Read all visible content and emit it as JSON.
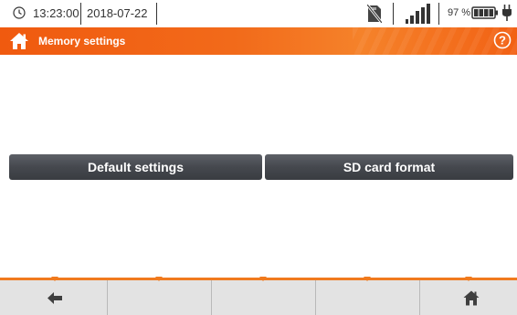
{
  "status": {
    "time": "13:23:00",
    "date": "2018-07-22",
    "battery_percent": "97 %",
    "battery_level": 0.97,
    "signal_bars": 5,
    "icons": [
      "clock-icon",
      "sd-card-crossed-icon",
      "signal-icon",
      "battery-icon",
      "plug-icon"
    ]
  },
  "header": {
    "title": "Memory settings",
    "home_icon": "home-icon",
    "help_icon": "help-icon",
    "accent_color": "#f26a1a"
  },
  "main": {
    "default_settings_label": "Default settings",
    "sd_format_label": "SD card format"
  },
  "bottom_bar": {
    "slots": 5,
    "left_icon": "back-arrow-icon",
    "right_icon": "home-icon"
  }
}
